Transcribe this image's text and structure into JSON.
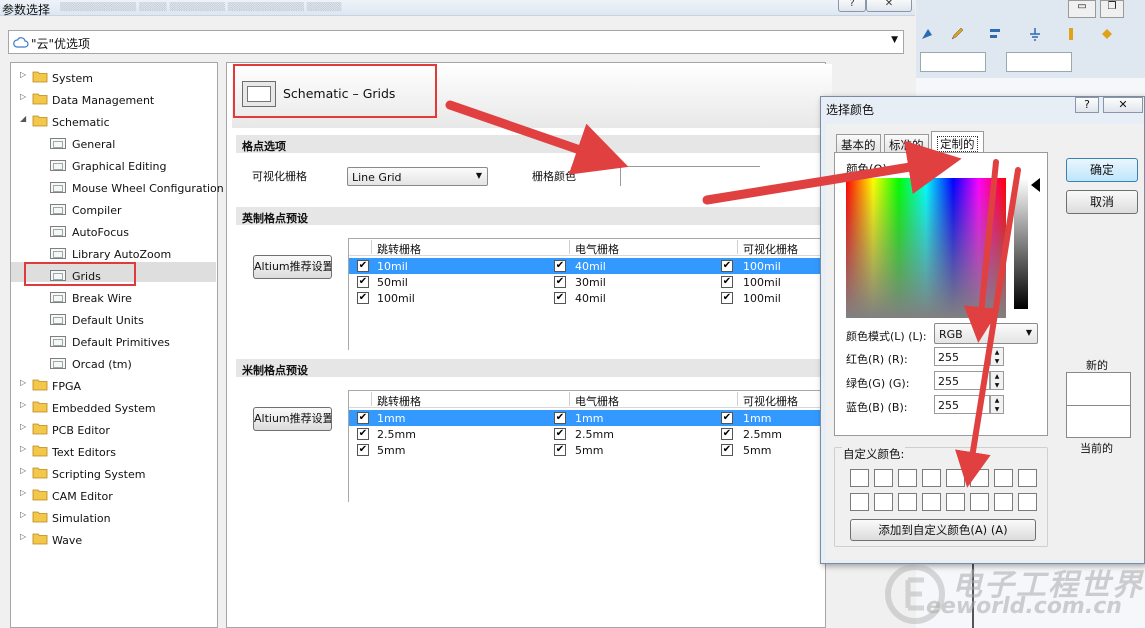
{
  "window": {
    "title": "参数选择",
    "help_glyph": "?",
    "close_glyph": "✕"
  },
  "cloud_bar": {
    "label": "\"云\"优选项",
    "icon": "cloud-icon"
  },
  "tree": [
    {
      "label": "System",
      "level": 0,
      "expanded": false
    },
    {
      "label": "Data Management",
      "level": 0,
      "expanded": false
    },
    {
      "label": "Schematic",
      "level": 0,
      "expanded": true
    },
    {
      "label": "General",
      "level": 1
    },
    {
      "label": "Graphical Editing",
      "level": 1
    },
    {
      "label": "Mouse Wheel Configuration",
      "level": 1
    },
    {
      "label": "Compiler",
      "level": 1
    },
    {
      "label": "AutoFocus",
      "level": 1
    },
    {
      "label": "Library AutoZoom",
      "level": 1
    },
    {
      "label": "Grids",
      "level": 1,
      "selected": true
    },
    {
      "label": "Break Wire",
      "level": 1
    },
    {
      "label": "Default Units",
      "level": 1
    },
    {
      "label": "Default Primitives",
      "level": 1
    },
    {
      "label": "Orcad (tm)",
      "level": 1
    },
    {
      "label": "FPGA",
      "level": 0,
      "expanded": false
    },
    {
      "label": "Embedded System",
      "level": 0,
      "expanded": false
    },
    {
      "label": "PCB Editor",
      "level": 0,
      "expanded": false
    },
    {
      "label": "Text Editors",
      "level": 0,
      "expanded": false
    },
    {
      "label": "Scripting System",
      "level": 0,
      "expanded": false
    },
    {
      "label": "CAM Editor",
      "level": 0,
      "expanded": false
    },
    {
      "label": "Simulation",
      "level": 0,
      "expanded": false
    },
    {
      "label": "Wave",
      "level": 0,
      "expanded": false
    }
  ],
  "content": {
    "header_title": "Schematic – Grids",
    "grid_options": {
      "section_title": "格点选项",
      "visible_grid_label": "可视化栅格",
      "visible_grid_value": "Line Grid",
      "grid_color_label": "栅格颜色"
    },
    "imperial": {
      "section_title": "英制格点预设",
      "preset_button": "Altium推荐设置",
      "columns": [
        "跳转栅格",
        "电气栅格",
        "可视化栅格"
      ],
      "rows": [
        {
          "snap": "10mil",
          "electrical": "40mil",
          "visible": "100mil",
          "selected": true
        },
        {
          "snap": "50mil",
          "electrical": "30mil",
          "visible": "100mil",
          "selected": false
        },
        {
          "snap": "100mil",
          "electrical": "40mil",
          "visible": "100mil",
          "selected": false
        }
      ]
    },
    "metric": {
      "section_title": "米制格点预设",
      "preset_button": "Altium推荐设置",
      "columns": [
        "跳转栅格",
        "电气栅格",
        "可视化栅格"
      ],
      "rows": [
        {
          "snap": "1mm",
          "electrical": "1mm",
          "visible": "1mm",
          "selected": true
        },
        {
          "snap": "2.5mm",
          "electrical": "2.5mm",
          "visible": "2.5mm",
          "selected": false
        },
        {
          "snap": "5mm",
          "electrical": "5mm",
          "visible": "5mm",
          "selected": false
        }
      ]
    }
  },
  "color_dialog": {
    "title": "选择颜色",
    "help_glyph": "?",
    "close_glyph": "✕",
    "tabs": [
      "基本的",
      "标准的",
      "定制的"
    ],
    "active_tab": "定制的",
    "palette_label": "颜色(O):",
    "mode_label": "颜色模式(L) (L):",
    "mode_value": "RGB",
    "red_label": "红色(R) (R):",
    "green_label": "绿色(G) (G):",
    "blue_label": "蓝色(B) (B):",
    "red": "255",
    "green": "255",
    "blue": "255",
    "ok_button": "确定",
    "cancel_button": "取消",
    "new_label": "新的",
    "current_label": "当前的",
    "custom_colors_label": "自定义颜色:",
    "add_custom_button": "添加到自定义颜色(A) (A)"
  },
  "watermark": {
    "text_cn": "电子工程世界",
    "text_en": "eeworld.com.cn"
  },
  "colors": {
    "annotation_red": "#e03a3a",
    "selection_blue": "#3399ff"
  }
}
